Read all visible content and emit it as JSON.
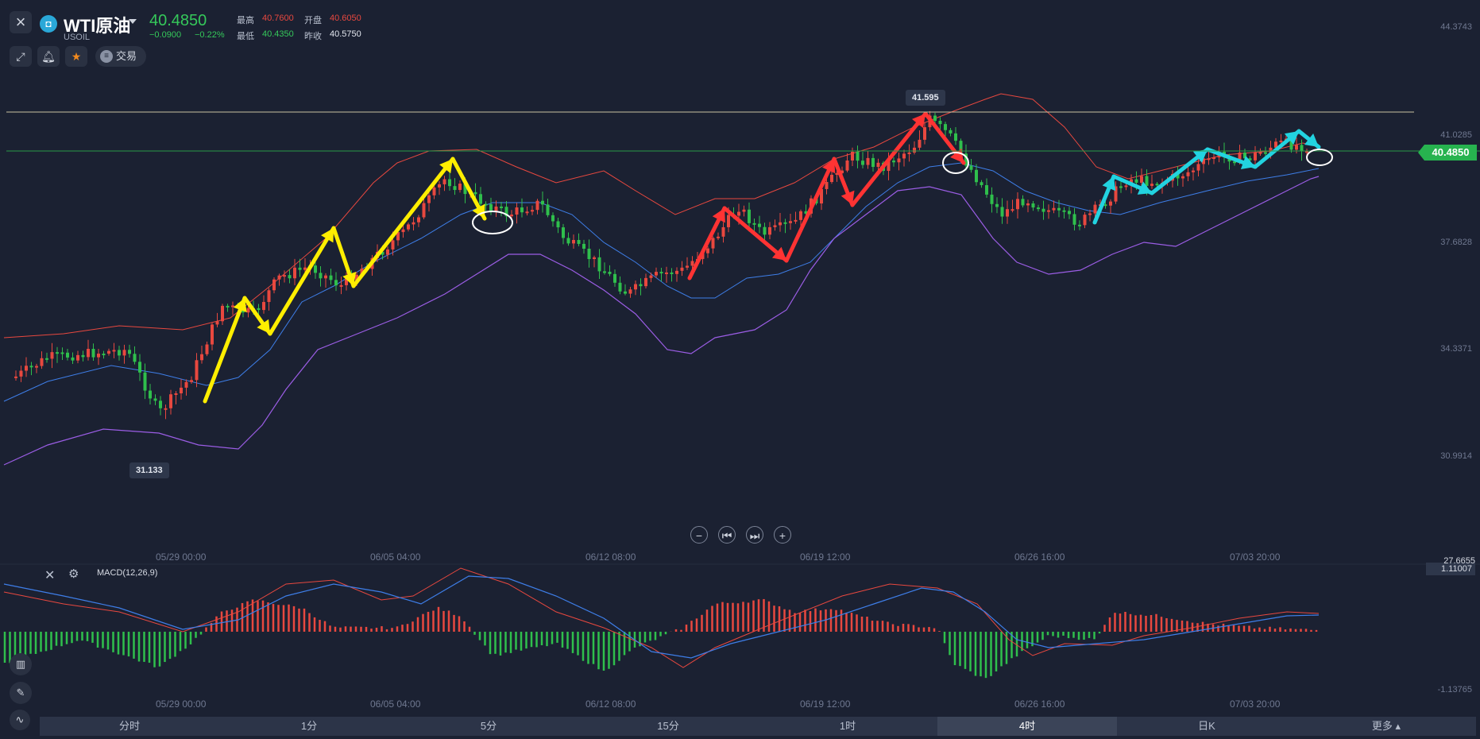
{
  "header": {
    "close_icon": "close-icon",
    "logo_text": "◘",
    "title": "WTI原油",
    "code": "USOIL",
    "price": "40.4850",
    "change": "−0.0900",
    "change_pct": "−0.22%",
    "high_label": "最高",
    "high_value": "40.7600",
    "open_label": "开盘",
    "open_value": "40.6050",
    "low_label": "最低",
    "low_value": "40.4350",
    "prev_label": "昨收",
    "prev_value": "40.5750"
  },
  "toolbar": {
    "draw_icon": "draw-tool-icon",
    "bell_icon": "bell-icon",
    "star_icon": "star-icon",
    "trade_label": "交易"
  },
  "price_axis": [
    "44.3743",
    "41.0285",
    "37.6828",
    "34.3371",
    "30.9914"
  ],
  "current_price_tag": "40.4850",
  "callouts": {
    "high": "41.595",
    "low": "31.133"
  },
  "date_axis": [
    "05/29 00:00",
    "06/05 04:00",
    "06/12 08:00",
    "06/19 12:00",
    "06/26 16:00",
    "07/03 20:00"
  ],
  "macd": {
    "label": "MACD(12,26,9)",
    "top_value": "1.11007",
    "bottom_value": "-1.13765",
    "overlay_value": "27.6655"
  },
  "timeframes": [
    "分时",
    "1分",
    "5分",
    "15分",
    "1时",
    "4时",
    "日K"
  ],
  "active_timeframe": "4时",
  "more_label": "更多",
  "colors": {
    "up": "#e8483f",
    "down": "#2fbf4c",
    "accent_green": "#35c85a",
    "yellow_arrow": "#ffee00",
    "red_arrow": "#ff3333",
    "cyan_arrow": "#22d3e0"
  }
}
